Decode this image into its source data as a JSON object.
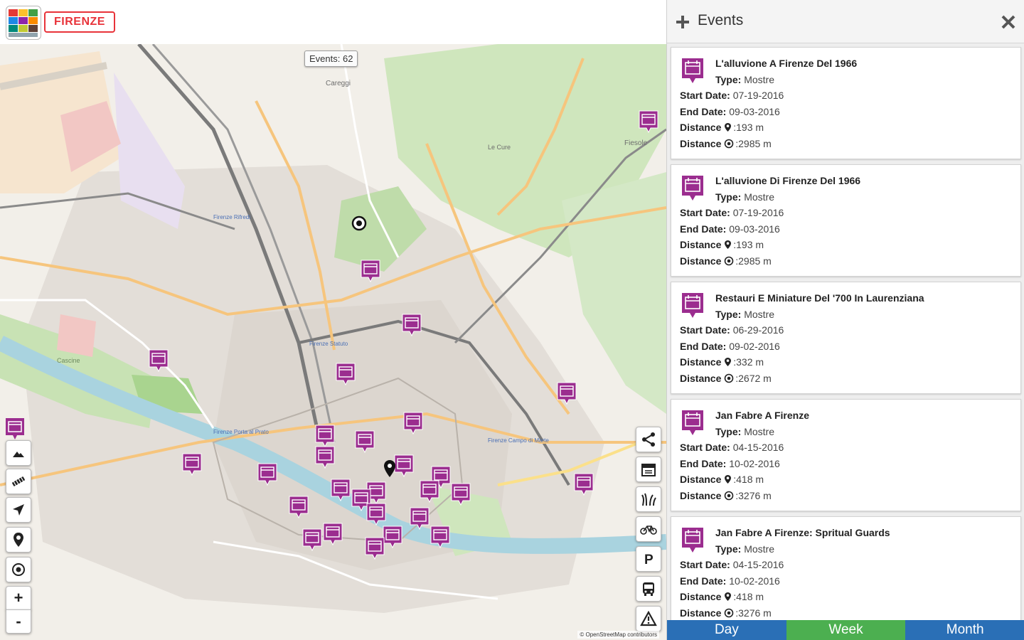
{
  "app": {
    "logo_icon": "firenze-app-logo-icon",
    "city_label": "FIRENZE"
  },
  "map": {
    "events_count_label": "Events: 62",
    "attribution": "© OpenStreetMap contributors",
    "place_labels": [
      "Careggi",
      "Fiesole",
      "Firenze Rifredi",
      "Firenze Statuto",
      "Firenze Porta al Prato",
      "Firenze Campo di Marte",
      "Le Cure",
      "Cascine"
    ],
    "left_controls": [
      {
        "name": "event-filter-button",
        "icon": "event-calendar-icon"
      },
      {
        "name": "terrain-layer-button",
        "icon": "terrain-icon"
      },
      {
        "name": "railway-layer-button",
        "icon": "railway-icon"
      },
      {
        "name": "navigate-button",
        "icon": "navigation-arrow-icon"
      },
      {
        "name": "pin-button",
        "icon": "map-pin-icon"
      },
      {
        "name": "locate-me-button",
        "icon": "target-icon"
      }
    ],
    "zoom_in": "+",
    "zoom_out": "-",
    "right_controls": [
      {
        "name": "share-button",
        "icon": "share-icon"
      },
      {
        "name": "calendar-button",
        "icon": "calendar-icon"
      },
      {
        "name": "grass-button",
        "icon": "grass-icon"
      },
      {
        "name": "bicycle-button",
        "icon": "bicycle-icon"
      },
      {
        "name": "parking-button",
        "icon": "parking-icon"
      },
      {
        "name": "bus-button",
        "icon": "bus-icon"
      },
      {
        "name": "warning-button",
        "icon": "warning-icon"
      }
    ],
    "marker_color": "#9b2d8f"
  },
  "panel": {
    "title": "Events",
    "add_icon": "plus-icon",
    "close_icon": "close-icon",
    "labels": {
      "type": "Type:",
      "start": "Start Date:",
      "end": "End Date:",
      "distance": "Distance"
    },
    "events": [
      {
        "title": "L'alluvione A Firenze Del 1966",
        "type": "Mostre",
        "start": "07-19-2016",
        "end": "09-03-2016",
        "walk": ":193 m",
        "drive": ":2985 m"
      },
      {
        "title": "L'alluvione Di Firenze Del 1966",
        "type": "Mostre",
        "start": "07-19-2016",
        "end": "09-03-2016",
        "walk": ":193 m",
        "drive": ":2985 m"
      },
      {
        "title": "Restauri E Miniature Del '700 In Laurenziana",
        "type": "Mostre",
        "start": "06-29-2016",
        "end": "09-02-2016",
        "walk": ":332 m",
        "drive": ":2672 m"
      },
      {
        "title": "Jan Fabre A Firenze",
        "type": "Mostre",
        "start": "04-15-2016",
        "end": "10-02-2016",
        "walk": ":418 m",
        "drive": ":3276 m"
      },
      {
        "title": "Jan Fabre A Firenze: Spritual Guards",
        "type": "Mostre",
        "start": "04-15-2016",
        "end": "10-02-2016",
        "walk": ":418 m",
        "drive": ":3276 m"
      }
    ],
    "tabs": [
      {
        "label": "Day",
        "color": "#2a6fb6"
      },
      {
        "label": "Week",
        "color": "#4caf50"
      },
      {
        "label": "Month",
        "color": "#2a6fb6"
      }
    ]
  }
}
